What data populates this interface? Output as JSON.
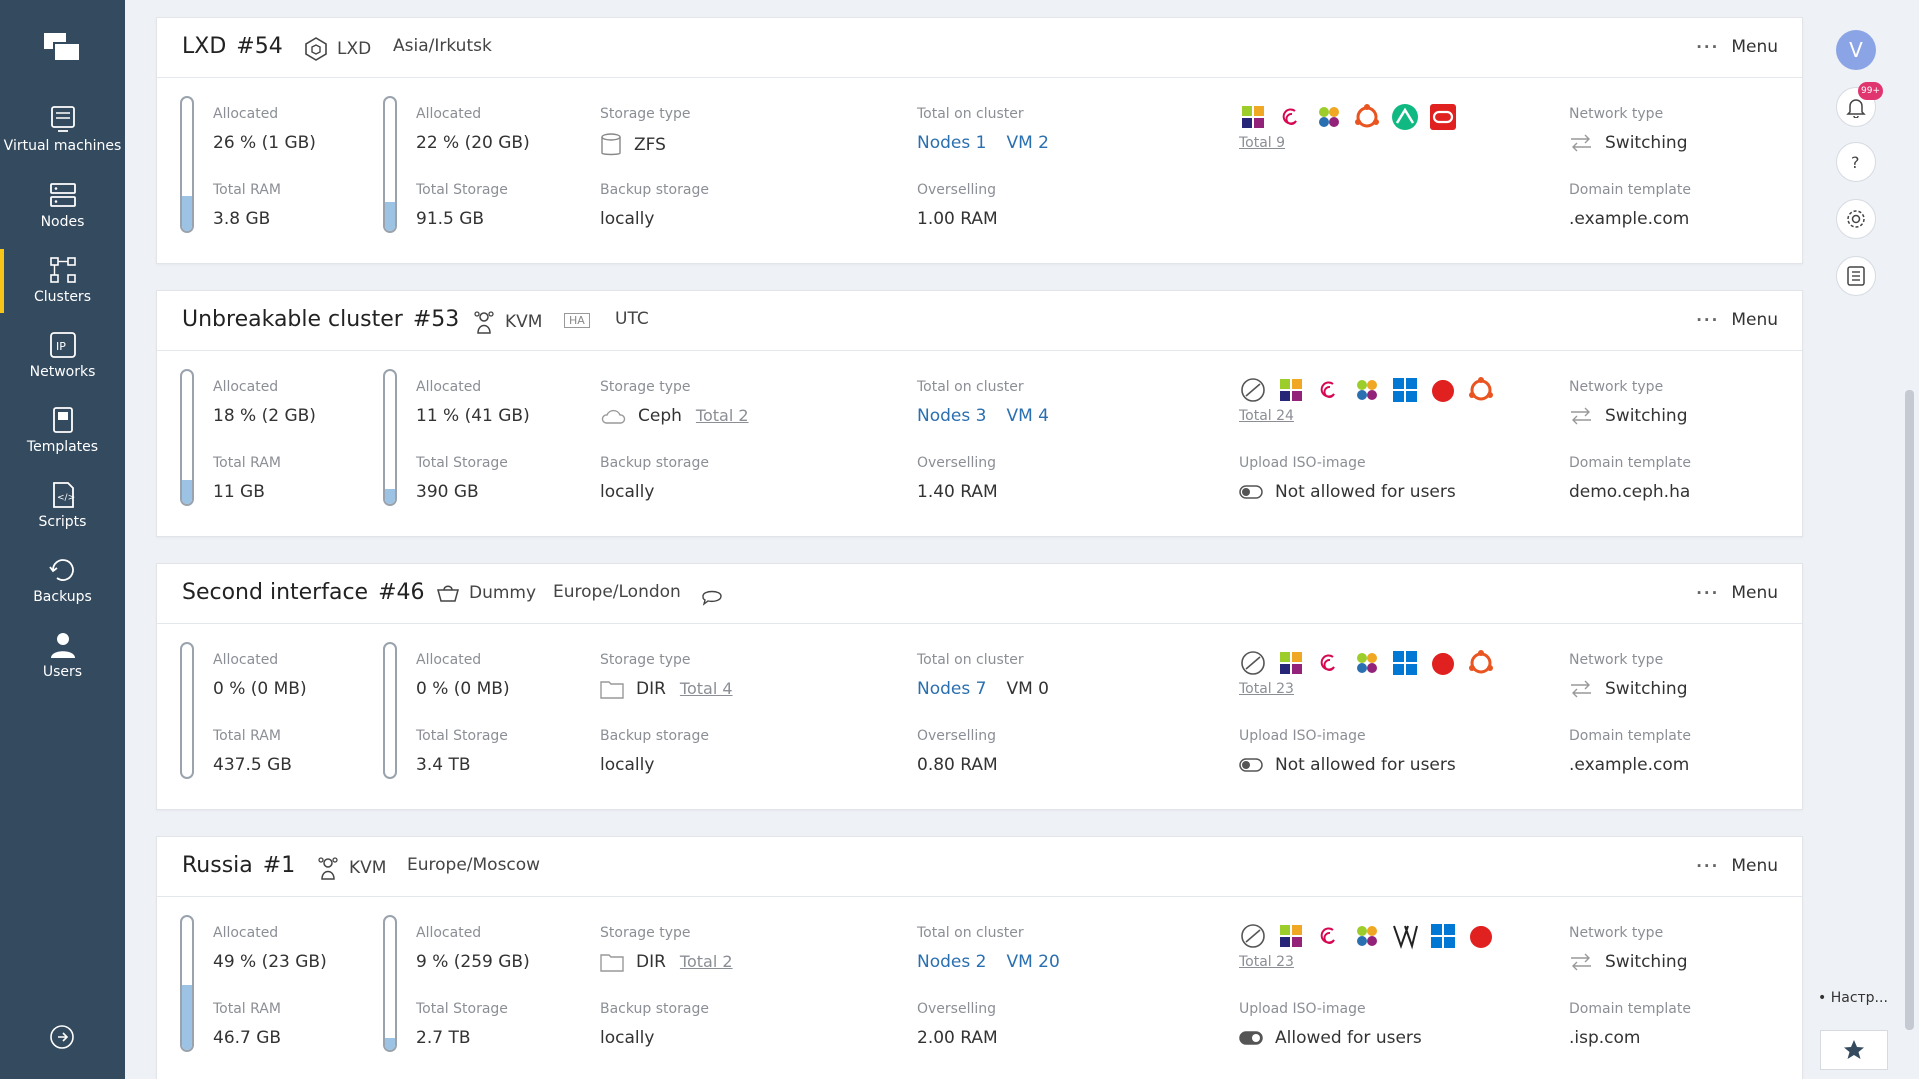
{
  "sidebar": {
    "items": [
      {
        "label": "Virtual machines",
        "icon": "monitor-icon"
      },
      {
        "label": "Nodes",
        "icon": "server-icon"
      },
      {
        "label": "Clusters",
        "icon": "cluster-icon"
      },
      {
        "label": "Networks",
        "icon": "ip-icon"
      },
      {
        "label": "Templates",
        "icon": "template-icon"
      },
      {
        "label": "Scripts",
        "icon": "script-icon"
      },
      {
        "label": "Backups",
        "icon": "backup-icon"
      },
      {
        "label": "Users",
        "icon": "user-icon"
      }
    ],
    "active": "Clusters",
    "accent": "#f5c518",
    "background": "#344a5f"
  },
  "rail": {
    "avatar": "V",
    "notifications_badge": "99+",
    "settings_label": "• Настр..."
  },
  "labels": {
    "allocated": "Allocated",
    "total_ram": "Total RAM",
    "total_storage": "Total Storage",
    "storage_type": "Storage type",
    "backup_storage": "Backup storage",
    "total_on_cluster": "Total on cluster",
    "overselling": "Overselling",
    "upload_iso": "Upload ISO-image",
    "network_type": "Network type",
    "domain_template": "Domain template",
    "menu": "Menu"
  },
  "clusters": [
    {
      "name": "LXD",
      "number": "#54",
      "virt": "LXD",
      "ha": "",
      "timezone": "Asia/Irkutsk",
      "ram_alloc": "26 % (1 GB)",
      "ram_fill": 0.26,
      "total_ram": "3.8 GB",
      "st_alloc": "22 % (20 GB)",
      "st_fill": 0.22,
      "total_storage": "91.5 GB",
      "storage_type": "ZFS",
      "storage_total": "",
      "backup": "locally",
      "nodes": "Nodes 1",
      "vms": "VM 2",
      "overselling": "1.00 RAM",
      "os_total": "Total 9",
      "upload_iso": "",
      "network": "Switching",
      "domain": ".example.com"
    },
    {
      "name": "Unbreakable cluster",
      "number": "#53",
      "virt": "KVM",
      "ha": "HA",
      "timezone": "UTC",
      "ram_alloc": "18 % (2 GB)",
      "ram_fill": 0.18,
      "total_ram": "11 GB",
      "st_alloc": "11 % (41 GB)",
      "st_fill": 0.11,
      "total_storage": "390 GB",
      "storage_type": "Ceph",
      "storage_total": "Total 2",
      "backup": "locally",
      "nodes": "Nodes 3",
      "vms": "VM 4",
      "overselling": "1.40 RAM",
      "os_total": "Total 24",
      "upload_iso": "Not allowed for users",
      "network": "Switching",
      "domain": "demo.ceph.ha"
    },
    {
      "name": "Second interface",
      "number": "#46",
      "virt": "Dummy",
      "ha": "",
      "timezone": "Europe/London",
      "ram_alloc": "0 % (0 MB)",
      "ram_fill": 0,
      "total_ram": "437.5 GB",
      "st_alloc": "0 % (0 MB)",
      "st_fill": 0,
      "total_storage": "3.4 TB",
      "storage_type": "DIR",
      "storage_total": "Total 4",
      "backup": "locally",
      "nodes": "Nodes 7",
      "vms": "VM 0",
      "overselling": "0.80 RAM",
      "os_total": "Total 23",
      "upload_iso": "Not allowed for users",
      "network": "Switching",
      "domain": ".example.com"
    },
    {
      "name": "Russia",
      "number": "#1",
      "virt": "KVM",
      "ha": "",
      "timezone": "Europe/Moscow",
      "ram_alloc": "49 % (23 GB)",
      "ram_fill": 0.49,
      "total_ram": "46.7 GB",
      "st_alloc": "9 % (259 GB)",
      "st_fill": 0.09,
      "total_storage": "2.7 TB",
      "storage_type": "DIR",
      "storage_total": "Total 2",
      "backup": "locally",
      "nodes": "Nodes 2",
      "vms": "VM 20",
      "overselling": "2.00 RAM",
      "os_total": "Total 23",
      "upload_iso": "Allowed for users",
      "network": "Switching",
      "domain": ".isp.com"
    }
  ]
}
